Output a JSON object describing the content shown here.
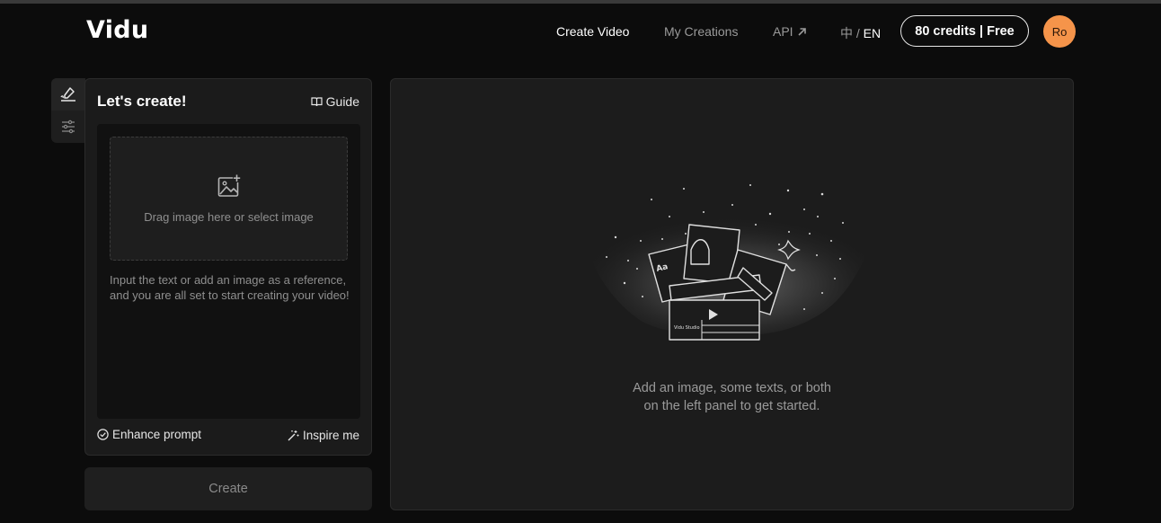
{
  "header": {
    "logo": "Vidu",
    "nav": {
      "create_video": "Create Video",
      "my_creations": "My Creations",
      "api": "API"
    },
    "lang": {
      "zh": "中",
      "sep": " / ",
      "en": "EN"
    },
    "credits": "80 credits | Free",
    "avatar": "Ro"
  },
  "sidebar": {
    "tabs": [
      {
        "icon": "brush-pen-icon"
      },
      {
        "icon": "sliders-icon"
      }
    ]
  },
  "panel": {
    "title": "Let's create!",
    "guide_label": "Guide",
    "dropzone_text": "Drag image here or select image",
    "prompt_placeholder": "Input the text or add an image as a reference, and you are all set to start creating your video!",
    "enhance_label": "Enhance prompt",
    "inspire_label": "Inspire me",
    "create_label": "Create"
  },
  "canvas": {
    "empty_line1": "Add an image, some texts, or both",
    "empty_line2": "on the left panel to get started.",
    "illustration_label": "Vidu Studio"
  },
  "colors": {
    "accent_avatar": "#f5944a",
    "background": "#0c0c0c",
    "panel": "#1b1b1b"
  }
}
